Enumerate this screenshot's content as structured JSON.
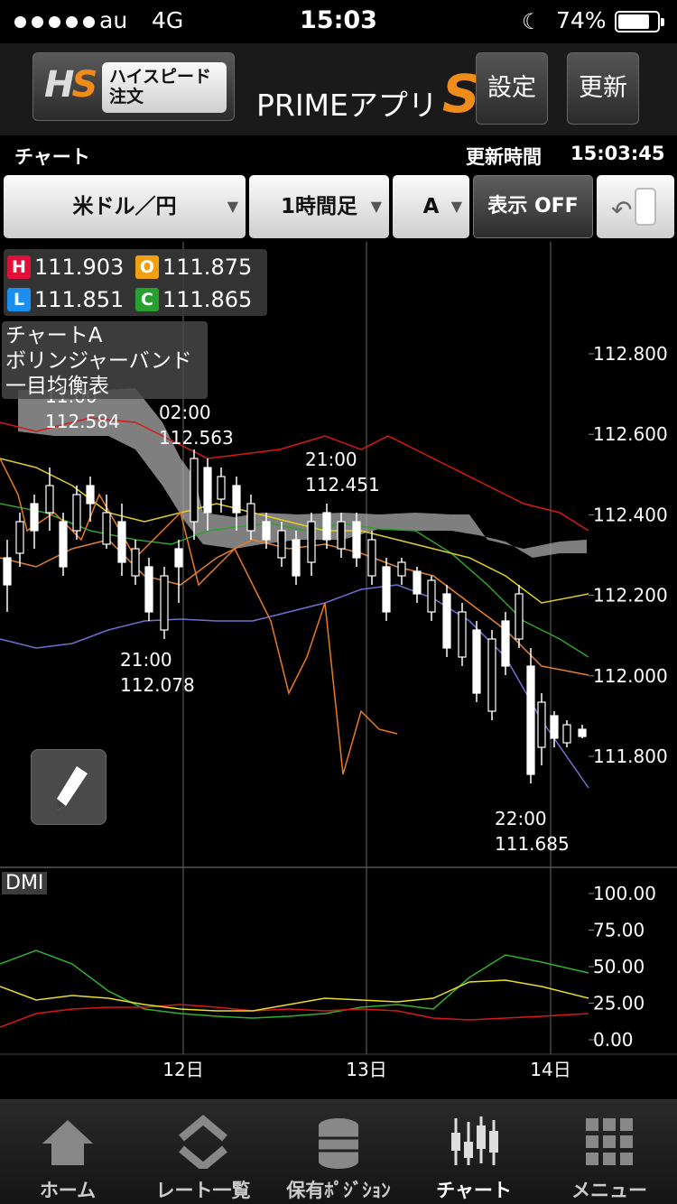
{
  "status_bar": {
    "carrier": "au",
    "network": "4G",
    "time": "15:03",
    "battery": "74%"
  },
  "header": {
    "hs_button": {
      "logo_h": "H",
      "logo_s": "S",
      "label_line1": "ハイスピード",
      "label_line2": "注文"
    },
    "app_title": "PRIMEアプリ",
    "app_badge": "S",
    "settings_label": "設定",
    "refresh_label": "更新"
  },
  "info_row": {
    "page_title": "チャート",
    "updated_label": "更新時間",
    "updated_time": "15:03:45"
  },
  "selectors": {
    "pair": "米ドル／円",
    "timeframe": "1時間足",
    "chart_slot": "A",
    "display_toggle": "表示 OFF"
  },
  "ohlc": {
    "high": "111.903",
    "open": "111.875",
    "low": "111.851",
    "close": "111.865",
    "h_badge": "H",
    "o_badge": "O",
    "l_badge": "L",
    "c_badge": "C"
  },
  "indicators": [
    "チャートA",
    "ボリンジャーバンド",
    "一目均衡表"
  ],
  "dmi_label": "DMI",
  "chart_data": {
    "type": "candlestick",
    "pair": "米ドル／円",
    "timeframe": "1時間足",
    "price_axis_ticks": [
      "112.800",
      "112.600",
      "112.400",
      "112.200",
      "112.000",
      "111.800"
    ],
    "dmi_axis_ticks": [
      "100.00",
      "75.00",
      "50.00",
      "25.00",
      "0.00"
    ],
    "date_ticks": [
      "12日",
      "13日",
      "14日"
    ],
    "annotations": [
      {
        "time": "11:00",
        "price": "112.584"
      },
      {
        "time": "02:00",
        "price": "112.563"
      },
      {
        "time": "21:00",
        "price": "112.451"
      },
      {
        "time": "21:00",
        "price": "112.078"
      },
      {
        "time": "22:00",
        "price": "111.685"
      }
    ],
    "colors": {
      "upper_band": "#d81818",
      "middle": "#e0d020",
      "lower_band": "#7070d0",
      "kumo": "#aaaaaa",
      "chikou": "#e87a20",
      "dmi_plus": "#30b030",
      "dmi_minus": "#d81818",
      "adx": "#e8e020"
    }
  },
  "tabs": [
    {
      "label": "ホーム",
      "icon": "home-icon"
    },
    {
      "label": "レート一覧",
      "icon": "rate-list-icon"
    },
    {
      "label": "保有ﾎﾟｼﾞｼｮﾝ",
      "icon": "positions-icon"
    },
    {
      "label": "チャート",
      "icon": "chart-icon"
    },
    {
      "label": "メニュー",
      "icon": "menu-grid-icon"
    }
  ]
}
